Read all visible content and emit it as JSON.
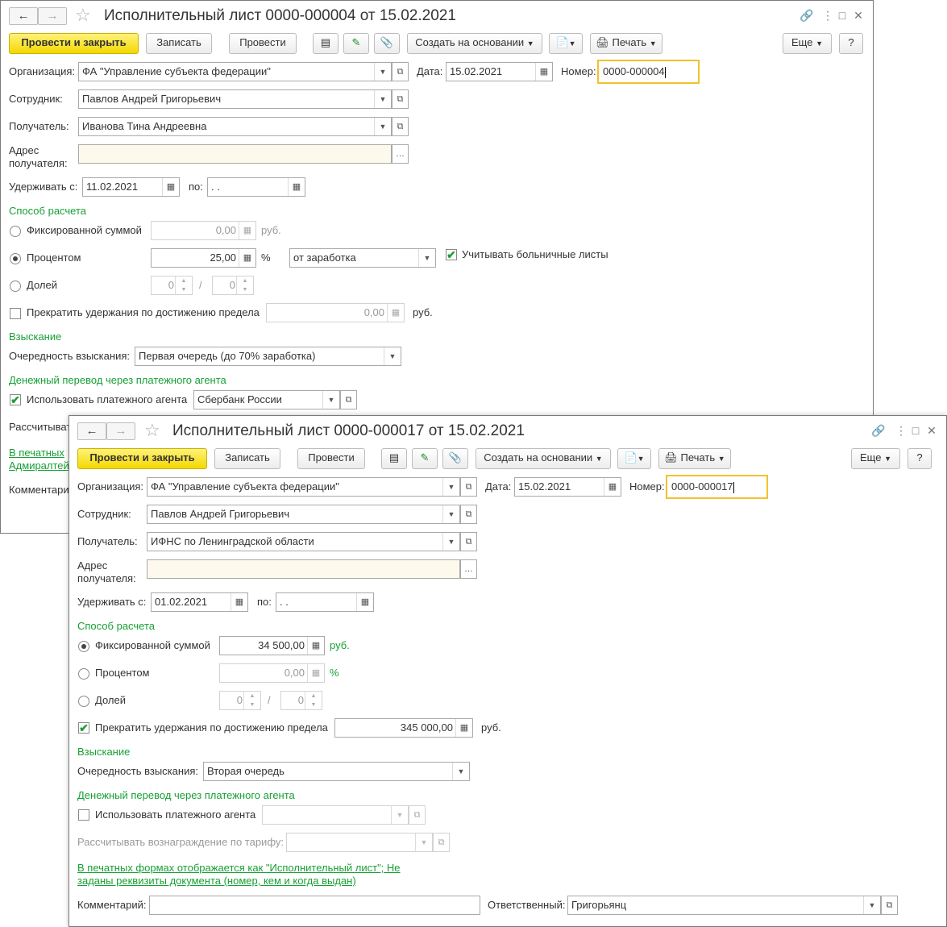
{
  "w1": {
    "title": "Исполнительный лист 0000-000004 от 15.02.2021",
    "toolbar": {
      "post_close": "Провести и закрыть",
      "save": "Записать",
      "post": "Провести",
      "create_basis": "Создать на основании",
      "print": "Печать",
      "more": "Еще",
      "help": "?"
    },
    "org_label": "Организация:",
    "org_value": "ФА \"Управление субъекта федерации\"",
    "date_label": "Дата:",
    "date_value": "15.02.2021",
    "number_label": "Номер:",
    "number_value": "0000-000004",
    "employee_label": "Сотрудник:",
    "employee_value": "Павлов Андрей Григорьевич",
    "recipient_label": "Получатель:",
    "recipient_value": "Иванова Тина Андреевна",
    "address_label_1": "Адрес",
    "address_label_2": "получателя:",
    "withhold_from_label": "Удерживать с:",
    "withhold_from_value": "11.02.2021",
    "to_label": "по:",
    "to_value": " .  .",
    "calc_method": "Способ расчета",
    "fixed_label": "Фиксированной суммой",
    "fixed_value": "0,00",
    "fixed_unit": "руб.",
    "percent_label": "Процентом",
    "percent_value": "25,00",
    "percent_unit": "%",
    "percent_base": "от заработка",
    "sick_label": "Учитывать больничные листы",
    "share_label": "Долей",
    "share_num": "0",
    "share_sep": "/",
    "share_den": "0",
    "stop_label": "Прекратить удержания по достижению предела",
    "stop_value": "0,00",
    "stop_unit": "руб.",
    "collection": "Взыскание",
    "priority_label": "Очередность взыскания:",
    "priority_value": "Первая очередь (до 70% заработка)",
    "transfer": "Денежный перевод через платежного агента",
    "agent_label": "Использовать платежного агента",
    "agent_value": "Сбербанк России",
    "calc_fee_partial": "Рассчитыват",
    "link_partial_1": "В печатных",
    "link_partial_2": "Адмиралтей",
    "comment_partial": "Комментари"
  },
  "w2": {
    "title": "Исполнительный лист 0000-000017 от 15.02.2021",
    "toolbar": {
      "post_close": "Провести и закрыть",
      "save": "Записать",
      "post": "Провести",
      "create_basis": "Создать на основании",
      "print": "Печать",
      "more": "Еще",
      "help": "?"
    },
    "org_label": "Организация:",
    "org_value": "ФА \"Управление субъекта федерации\"",
    "date_label": "Дата:",
    "date_value": "15.02.2021",
    "number_label": "Номер:",
    "number_value": "0000-000017",
    "employee_label": "Сотрудник:",
    "employee_value": "Павлов Андрей Григорьевич",
    "recipient_label": "Получатель:",
    "recipient_value": "ИФНС по Ленинградской области",
    "address_label_1": "Адрес",
    "address_label_2": "получателя:",
    "withhold_from_label": "Удерживать с:",
    "withhold_from_value": "01.02.2021",
    "to_label": "по:",
    "to_value": " .  .",
    "calc_method": "Способ расчета",
    "fixed_label": "Фиксированной суммой",
    "fixed_value": "34 500,00",
    "fixed_unit": "руб.",
    "percent_label": "Процентом",
    "percent_value": "0,00",
    "percent_unit": "%",
    "share_label": "Долей",
    "share_num": "0",
    "share_sep": "/",
    "share_den": "0",
    "stop_label": "Прекратить удержания по достижению предела",
    "stop_value": "345 000,00",
    "stop_unit": "руб.",
    "collection": "Взыскание",
    "priority_label": "Очередность взыскания:",
    "priority_value": "Вторая очередь",
    "transfer": "Денежный перевод через платежного агента",
    "agent_label": "Использовать платежного агента",
    "agent_value": "",
    "fee_label": "Рассчитывать вознаграждение по тарифу:",
    "fee_value": "",
    "link_text": "В печатных формах отображается как \"Исполнительный лист\"; Не заданы реквизиты документа (номер, кем и когда выдан)",
    "comment_label": "Комментарий:",
    "comment_value": "",
    "responsible_label": "Ответственный:",
    "responsible_value": "Григорьянц"
  },
  "icons": [
    "link-icon",
    "more-vert-icon",
    "restore-icon",
    "close-icon",
    "journal-icon",
    "sign-icon",
    "attach-icon",
    "report-icon",
    "printer-icon"
  ]
}
